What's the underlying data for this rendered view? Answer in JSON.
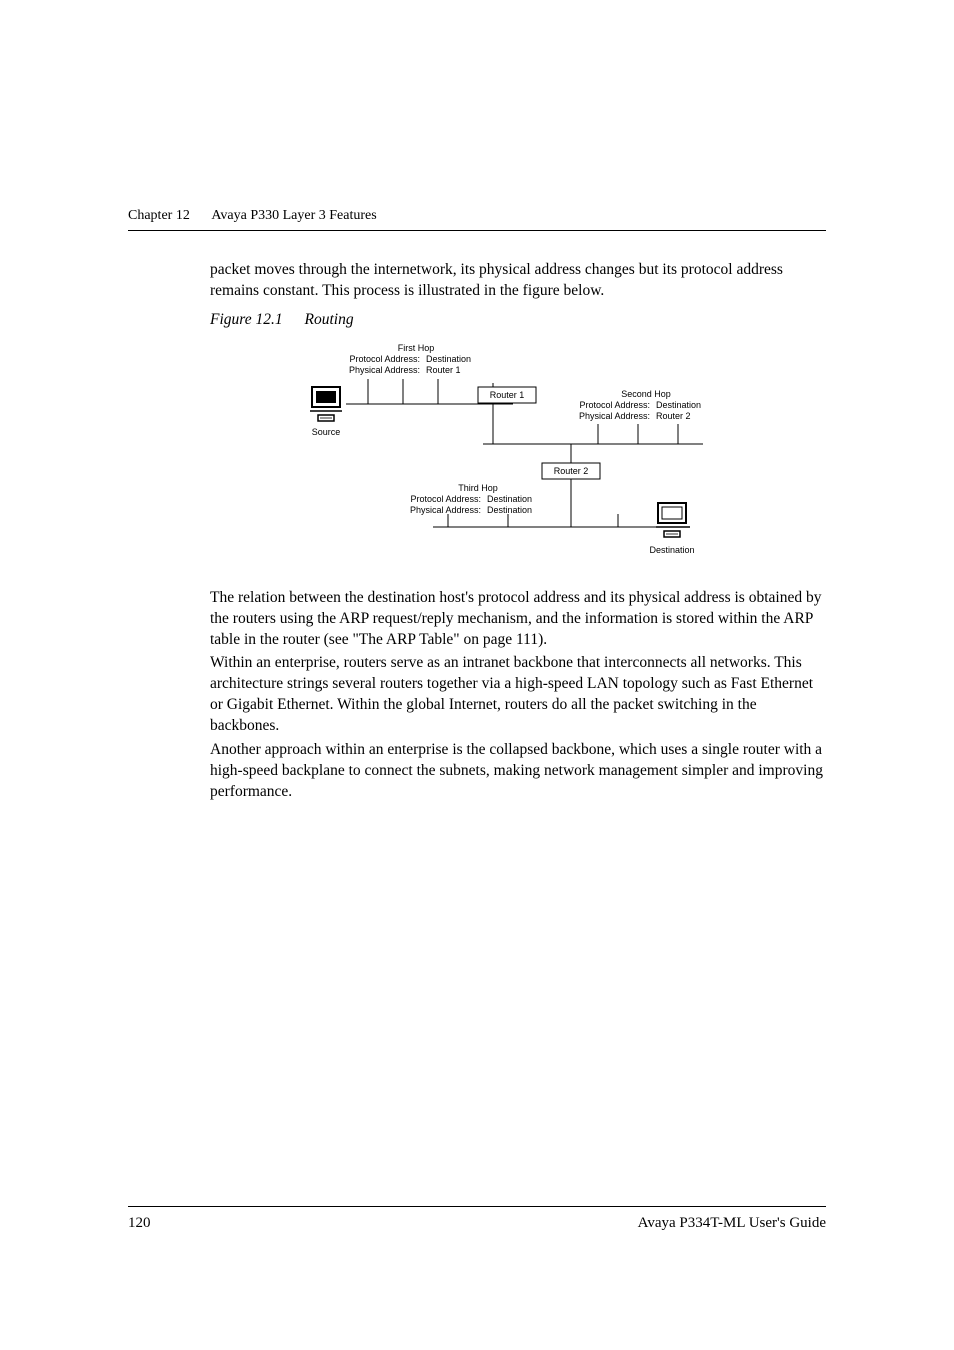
{
  "header": {
    "chapter": "Chapter 12",
    "title": "Avaya P330 Layer 3 Features"
  },
  "intro": {
    "p1": "packet moves through the internetwork, its physical address changes but its protocol address remains constant. This process is illustrated in the figure below."
  },
  "figure": {
    "label": "Figure 12.1",
    "title": "Routing",
    "firstHop": {
      "title": "First Hop",
      "line1": "Protocol Address:",
      "val1": "Destination",
      "line2": "Physical Address:",
      "val2": "Router 1"
    },
    "secondHop": {
      "title": "Second Hop",
      "line1": "Protocol Address:",
      "val1": "Destination",
      "line2": "Physical Address:",
      "val2": "Router 2"
    },
    "thirdHop": {
      "title": "Third Hop",
      "line1": "Protocol Address:",
      "val1": "Destination",
      "line2": "Physical Address:",
      "val2": "Destination"
    },
    "source": "Source",
    "router1": "Router 1",
    "router2": "Router 2",
    "destination": "Destination"
  },
  "body": {
    "p2": "The relation between the destination host's protocol address and its physical address is obtained by the routers using the ARP request/reply mechanism, and the information is stored within the ARP table in the router (see \"The ARP Table\" on page 111).",
    "p3": "Within an enterprise, routers serve as an intranet backbone that interconnects all networks. This architecture strings several routers together via a high-speed LAN topology such as Fast Ethernet or Gigabit Ethernet. Within the global Internet, routers do all the packet switching in the backbones.",
    "p4": "Another approach within an enterprise is the collapsed backbone, which uses a single router with a high-speed backplane to connect the subnets, making network management simpler and improving performance."
  },
  "footer": {
    "pageNum": "120",
    "guide": "Avaya P334T-ML User's Guide"
  }
}
